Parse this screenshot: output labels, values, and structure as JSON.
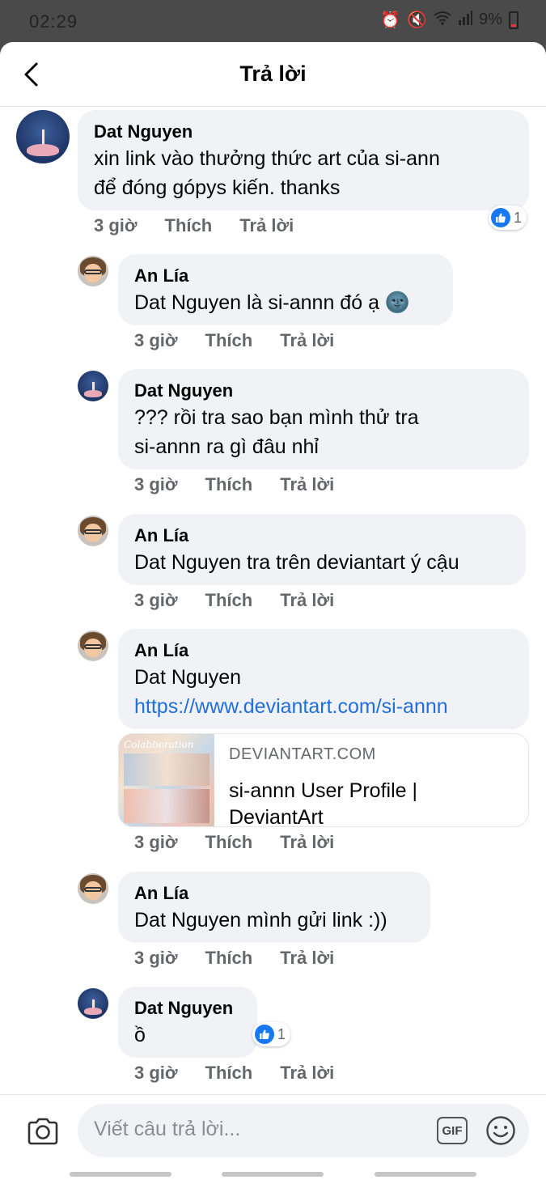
{
  "status_bar": {
    "time": "02:29",
    "battery": "9%"
  },
  "header": {
    "title": "Trả lời"
  },
  "comments": [
    {
      "author": "Dat Nguyen",
      "text": [
        "xin link vào thưởng thức art của si-ann",
        "để đóng gópys kiến. thanks"
      ],
      "time": "3 giờ",
      "like": "Thích",
      "reply": "Trả lời",
      "reactions": "1"
    },
    {
      "author": "An Lía",
      "text": [
        "Dat Nguyen là si-annn đó ạ 🌚"
      ],
      "time": "3 giờ",
      "like": "Thích",
      "reply": "Trả lời"
    },
    {
      "author": "Dat Nguyen",
      "text": [
        "??? rồi tra sao bạn mình thử tra",
        "si-annn ra gì đâu nhỉ"
      ],
      "time": "3 giờ",
      "like": "Thích",
      "reply": "Trả lời"
    },
    {
      "author": "An Lía",
      "text": [
        "Dat Nguyen tra trên deviantart ý cậu"
      ],
      "time": "3 giờ",
      "like": "Thích",
      "reply": "Trả lời"
    },
    {
      "author": "An Lía",
      "text": [
        "Dat Nguyen"
      ],
      "link": "https://www.deviantart.com/si-annn",
      "time": "3 giờ",
      "like": "Thích",
      "reply": "Trả lời",
      "link_card": {
        "domain": "DEVIANTART.COM",
        "title": "si-annn User Profile | DeviantArt",
        "thumb_text": "Colabboration"
      }
    },
    {
      "author": "An Lía",
      "text": [
        "Dat Nguyen mình gửi link :))"
      ],
      "time": "3 giờ",
      "like": "Thích",
      "reply": "Trả lời"
    },
    {
      "author": "Dat Nguyen",
      "text": [
        "ồ"
      ],
      "time": "3 giờ",
      "like": "Thích",
      "reply": "Trả lời",
      "reactions": "1"
    }
  ],
  "composer": {
    "placeholder": "Viết câu trả lời...",
    "gif_label": "GIF"
  },
  "colors": {
    "link": "#216fdb",
    "like_blue": "#1877f2",
    "bubble": "#f0f2f5"
  }
}
